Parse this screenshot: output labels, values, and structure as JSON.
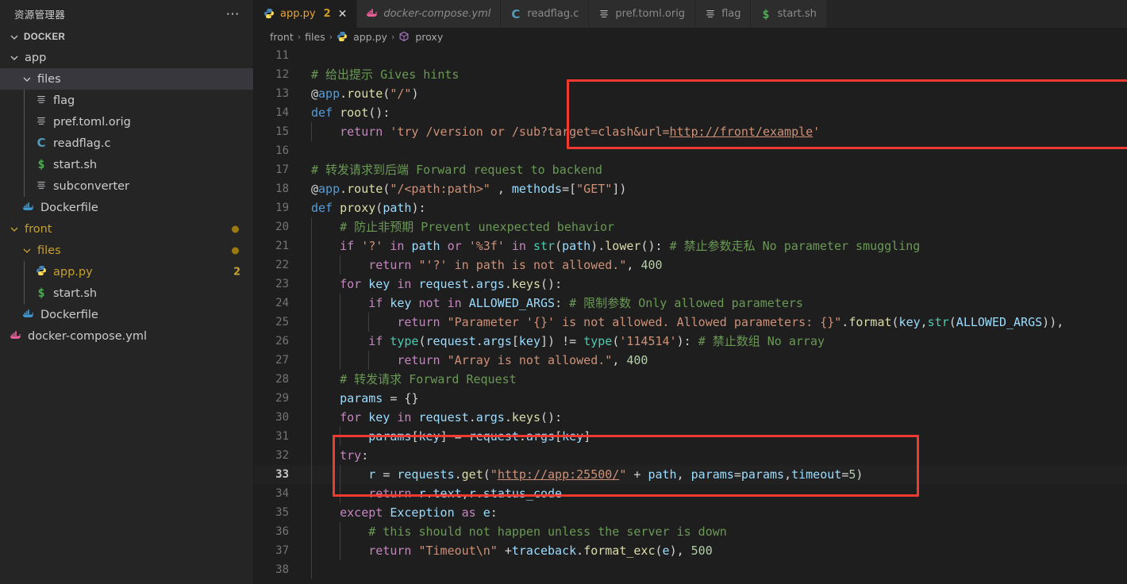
{
  "sidebar": {
    "title": "资源管理器",
    "more_icon": "ellipsis-icon",
    "section": {
      "label": "DOCKER",
      "expanded": true
    },
    "items": [
      {
        "label": "app",
        "type": "folder",
        "depth": 1,
        "icon": "chevron-down-icon",
        "expanded": true,
        "selected": false,
        "color": "#cccccc"
      },
      {
        "label": "files",
        "type": "folder",
        "depth": 2,
        "icon": "chevron-down-icon",
        "expanded": true,
        "selected": true,
        "color": "#cccccc"
      },
      {
        "label": "flag",
        "type": "file",
        "depth": 3,
        "icon": "text-file-icon",
        "selected": false,
        "color": "#cccccc"
      },
      {
        "label": "pref.toml.orig",
        "type": "file",
        "depth": 3,
        "icon": "text-file-icon",
        "selected": false,
        "color": "#cccccc"
      },
      {
        "label": "readflag.c",
        "type": "file",
        "depth": 3,
        "icon": "c-file-icon",
        "selected": false,
        "color": "#cccccc"
      },
      {
        "label": "start.sh",
        "type": "file",
        "depth": 3,
        "icon": "shell-file-icon",
        "selected": false,
        "color": "#cccccc"
      },
      {
        "label": "subconverter",
        "type": "file",
        "depth": 3,
        "icon": "text-file-icon",
        "selected": false,
        "color": "#cccccc"
      },
      {
        "label": "Dockerfile",
        "type": "file",
        "depth": 2,
        "icon": "docker-blue-icon",
        "selected": false,
        "color": "#cccccc"
      },
      {
        "label": "front",
        "type": "folder",
        "depth": 1,
        "icon": "chevron-down-icon",
        "expanded": true,
        "selected": false,
        "color": "#c8a02a",
        "badge_dot": "#9a7a10"
      },
      {
        "label": "files",
        "type": "folder",
        "depth": 2,
        "icon": "chevron-down-icon",
        "expanded": true,
        "selected": false,
        "color": "#c8a02a",
        "badge_dot": "#9a7a10"
      },
      {
        "label": "app.py",
        "type": "file",
        "depth": 3,
        "icon": "python-file-icon",
        "selected": false,
        "color": "#c8a02a",
        "badge_num": "2",
        "badge_num_color": "#c8a02a"
      },
      {
        "label": "start.sh",
        "type": "file",
        "depth": 3,
        "icon": "shell-file-icon",
        "selected": false,
        "color": "#cccccc"
      },
      {
        "label": "Dockerfile",
        "type": "file",
        "depth": 2,
        "icon": "docker-blue-icon",
        "selected": false,
        "color": "#cccccc"
      },
      {
        "label": "docker-compose.yml",
        "type": "file",
        "depth": 1,
        "icon": "docker-pink-icon",
        "selected": false,
        "color": "#cccccc"
      }
    ]
  },
  "tabs": [
    {
      "label": "app.py",
      "icon": "python-file-icon",
      "active": true,
      "italic": false,
      "count": "2",
      "close": "✕"
    },
    {
      "label": "docker-compose.yml",
      "icon": "docker-pink-icon",
      "active": false,
      "italic": true
    },
    {
      "label": "readflag.c",
      "icon": "c-file-icon",
      "active": false,
      "italic": false
    },
    {
      "label": "pref.toml.orig",
      "icon": "text-file-icon",
      "active": false,
      "italic": false
    },
    {
      "label": "flag",
      "icon": "text-file-icon",
      "active": false,
      "italic": false
    },
    {
      "label": "start.sh",
      "icon": "shell-file-icon",
      "active": false,
      "italic": false
    }
  ],
  "breadcrumb": [
    {
      "label": "front",
      "icon": null
    },
    {
      "label": "files",
      "icon": null
    },
    {
      "label": "app.py",
      "icon": "python-file-icon"
    },
    {
      "label": "proxy",
      "icon": "symbol-method-icon"
    }
  ],
  "breadcrumb_separator": "›",
  "editor": {
    "language": "python",
    "current_line": 33,
    "first_visible_line": 11,
    "lines": [
      {
        "n": "11",
        "text": ""
      },
      {
        "n": "12",
        "text": "# 给出提示 Gives hints"
      },
      {
        "n": "13",
        "text": "@app.route(\"/\")"
      },
      {
        "n": "14",
        "text": "def root():"
      },
      {
        "n": "15",
        "text": "    return 'try /version or /sub?target=clash&url=http://front/example'"
      },
      {
        "n": "16",
        "text": ""
      },
      {
        "n": "17",
        "text": "# 转发请求到后端 Forward request to backend"
      },
      {
        "n": "18",
        "text": "@app.route(\"/<path:path>\" , methods=[\"GET\"])"
      },
      {
        "n": "19",
        "text": "def proxy(path):"
      },
      {
        "n": "20",
        "text": "    # 防止非预期 Prevent unexpected behavior"
      },
      {
        "n": "21",
        "text": "    if '?' in path or '%3f' in str(path).lower(): # 禁止参数走私 No parameter smuggling"
      },
      {
        "n": "22",
        "text": "        return \"'?' in path is not allowed.\", 400"
      },
      {
        "n": "23",
        "text": "    for key in request.args.keys():"
      },
      {
        "n": "24",
        "text": "        if key not in ALLOWED_ARGS: # 限制参数 Only allowed parameters"
      },
      {
        "n": "25",
        "text": "            return \"Parameter '{}' is not allowed. Allowed parameters: {}\".format(key,str(ALLOWED_ARGS)),"
      },
      {
        "n": "26",
        "text": "        if type(request.args[key]) != type('114514'): # 禁止数组 No array"
      },
      {
        "n": "27",
        "text": "            return \"Array is not allowed.\", 400"
      },
      {
        "n": "28",
        "text": "    # 转发请求 Forward Request"
      },
      {
        "n": "29",
        "text": "    params = {}"
      },
      {
        "n": "30",
        "text": "    for key in request.args.keys():"
      },
      {
        "n": "31",
        "text": "        params[key] = request.args[key]"
      },
      {
        "n": "32",
        "text": "    try:"
      },
      {
        "n": "33",
        "text": "        r = requests.get(\"http://app:25500/\" + path, params=params,timeout=5)"
      },
      {
        "n": "34",
        "text": "        return r.text,r.status_code"
      },
      {
        "n": "35",
        "text": "    except Exception as e:"
      },
      {
        "n": "36",
        "text": "        # this should not happen unless the server is down"
      },
      {
        "n": "37",
        "text": "        return \"Timeout\\n\" +traceback.format_exc(e), 500"
      },
      {
        "n": "38",
        "text": ""
      }
    ],
    "annotations": [
      {
        "name": "redbox-root-route",
        "lines": "13-16",
        "color": "#f03a2f"
      },
      {
        "name": "redbox-try-block",
        "lines": "32-34",
        "color": "#f03a2f"
      }
    ]
  },
  "colors": {
    "sidebar_bg": "#252526",
    "editor_bg": "#1e1e1e",
    "tabbar_bg": "#252526",
    "active_tab_bg": "#1e1e1e",
    "selection_bg": "#37373d",
    "modified_accent": "#c8a02a",
    "annotation_red": "#f03a2f"
  }
}
